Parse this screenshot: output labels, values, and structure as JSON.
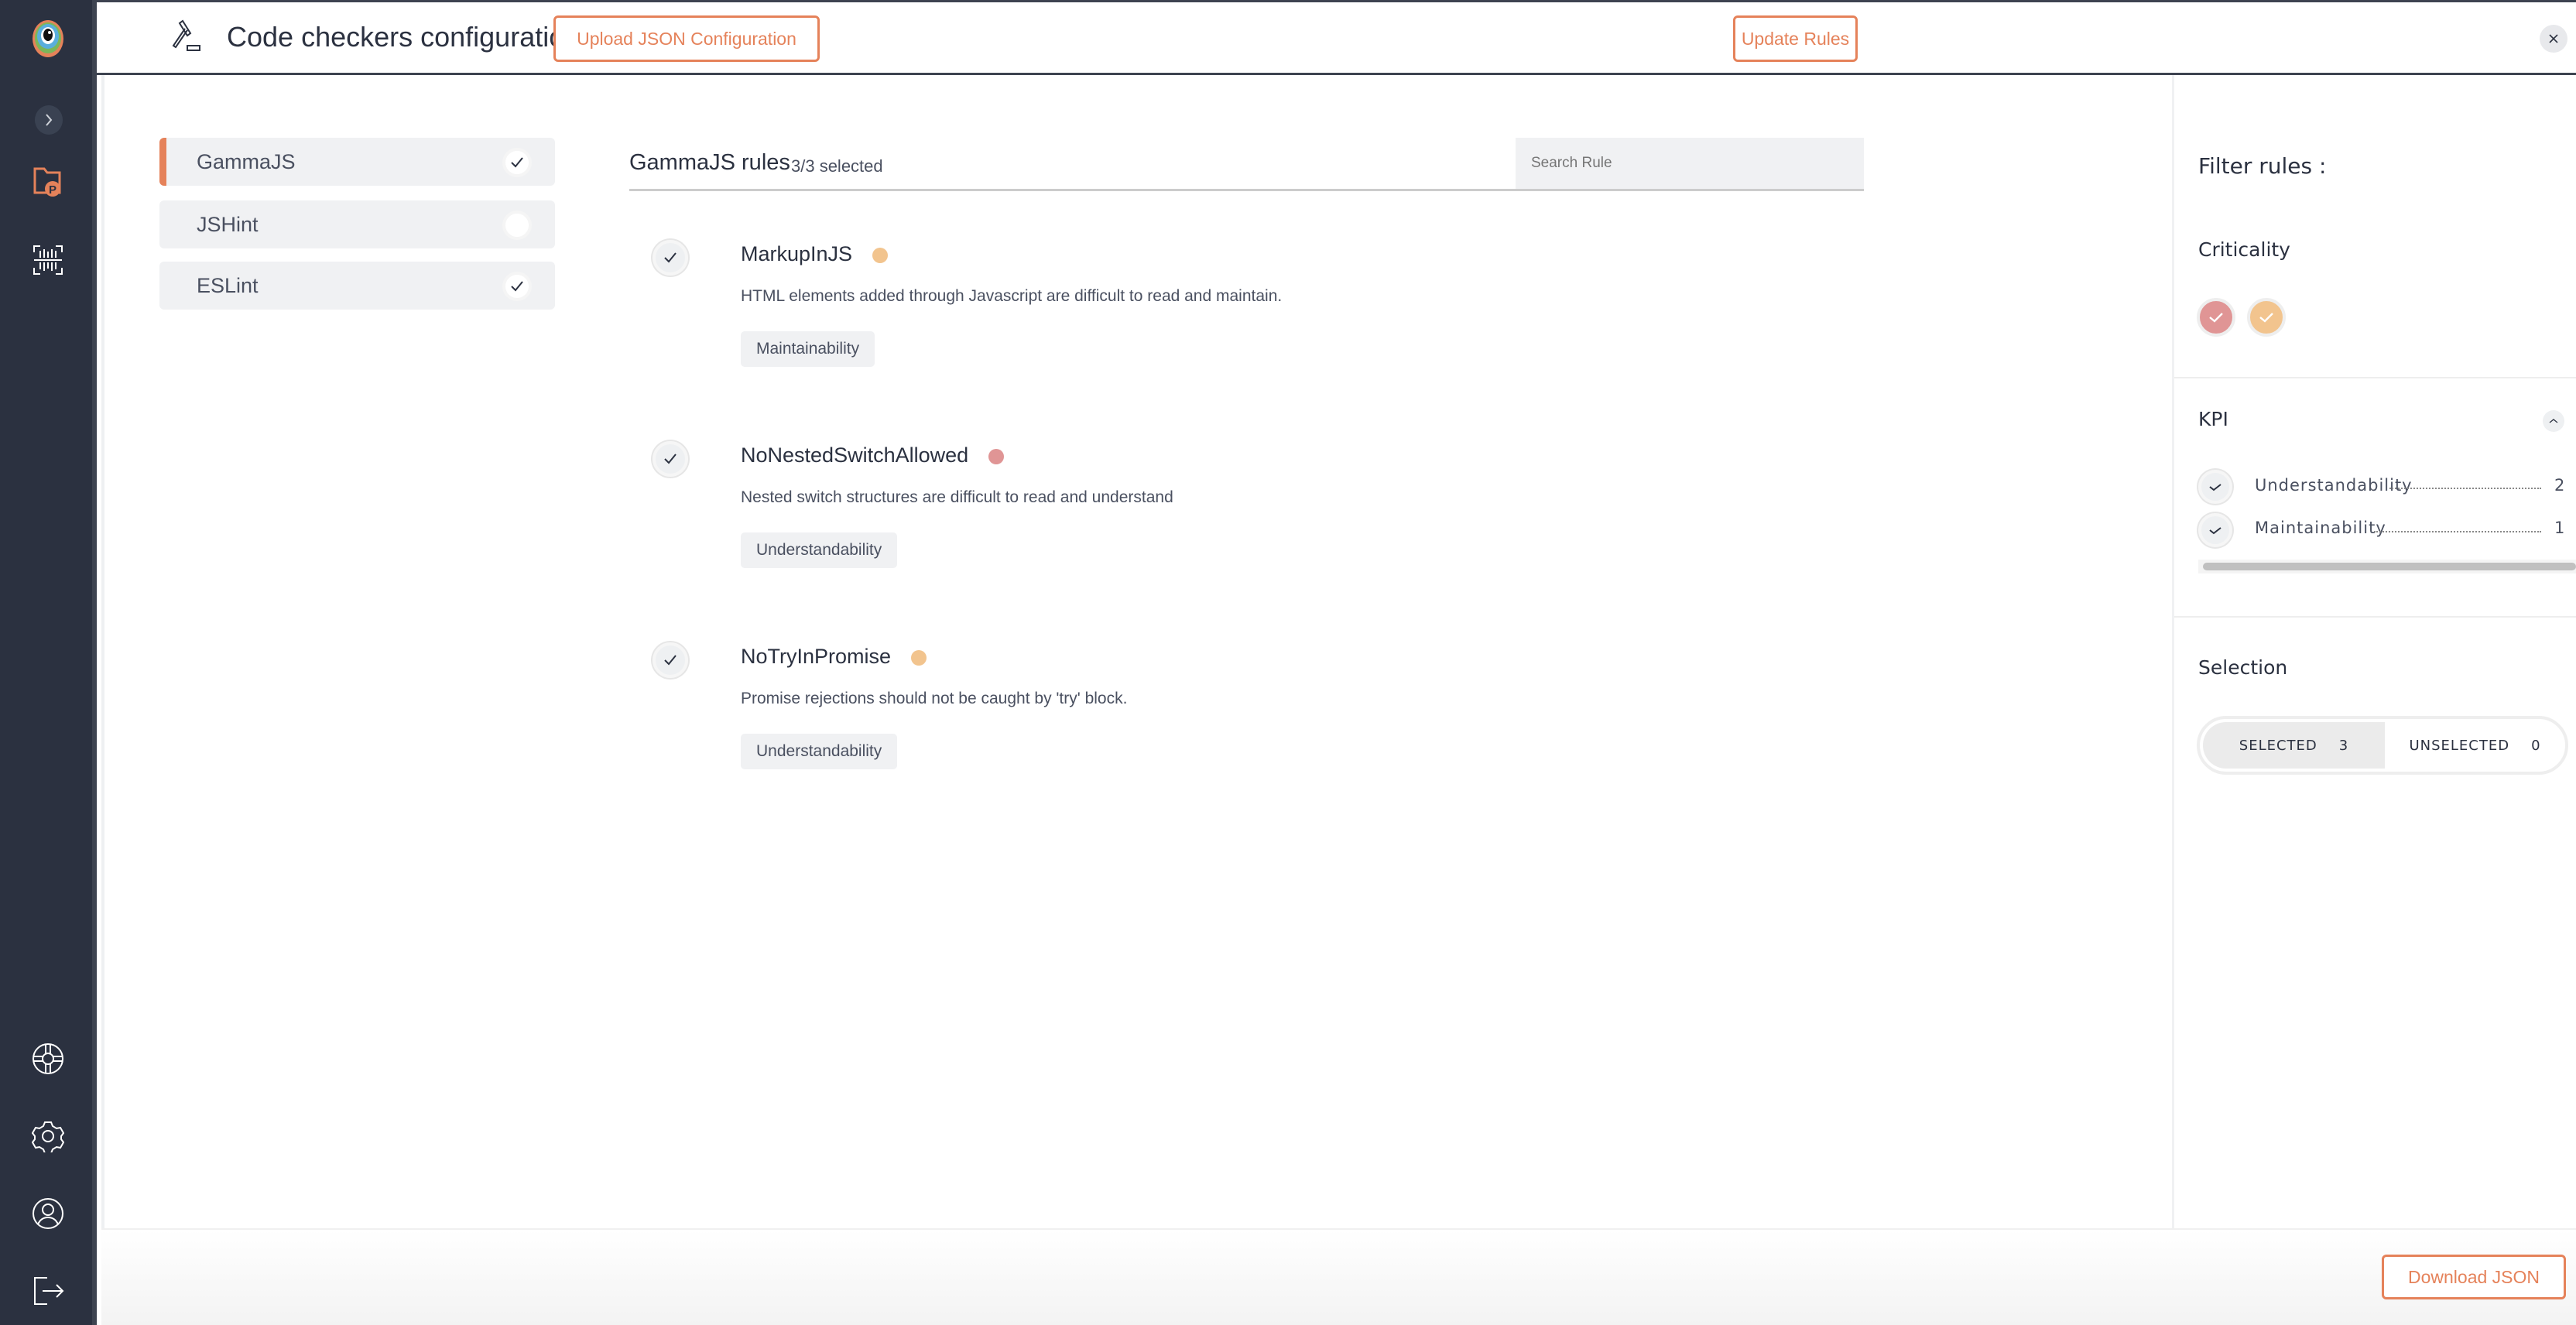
{
  "sidebar": {
    "items": [
      {
        "icon": "app-logo-icon"
      },
      {
        "icon": "chevron-right-icon"
      },
      {
        "icon": "project-folder-icon"
      },
      {
        "icon": "barcode-scan-icon"
      },
      {
        "icon": "help-lifebuoy-icon"
      },
      {
        "icon": "gear-icon"
      },
      {
        "icon": "user-icon"
      },
      {
        "icon": "logout-icon"
      }
    ]
  },
  "header": {
    "title": "Code checkers configuration",
    "icon": "gavel-icon",
    "upload_label": "Upload JSON Configuration",
    "update_label": "Update Rules",
    "close_icon": "close-icon"
  },
  "checkers": [
    {
      "label": "GammaJS",
      "checked": true,
      "active": true
    },
    {
      "label": "JSHint",
      "checked": false,
      "active": false
    },
    {
      "label": "ESLint",
      "checked": true,
      "active": false
    }
  ],
  "rules_panel": {
    "title": "GammaJS rules",
    "count": "3/3 selected",
    "search_placeholder": "Search Rule"
  },
  "rules": [
    {
      "name": "MarkupInJS",
      "criticality_color": "#f2c48e",
      "description": "HTML elements added through Javascript are difficult to read and maintain.",
      "tag": "Maintainability",
      "checked": true
    },
    {
      "name": "NoNestedSwitchAllowed",
      "criticality_color": "#e09595",
      "description": "Nested switch structures are difficult to read and understand",
      "tag": "Understandability",
      "checked": true
    },
    {
      "name": "NoTryInPromise",
      "criticality_color": "#f2c48e",
      "description": "Promise rejections should not be caught by 'try' block.",
      "tag": "Understandability",
      "checked": true
    }
  ],
  "filters": {
    "title": "Filter rules :",
    "criticality": {
      "label": "Criticality",
      "colors": [
        "#e09595",
        "#f2c48e"
      ]
    },
    "kpi": {
      "label": "KPI",
      "items": [
        {
          "label": "Understandability",
          "count": "2"
        },
        {
          "label": "Maintainability",
          "count": "1"
        }
      ]
    },
    "selection": {
      "label": "Selection",
      "selected_label": "SELECTED",
      "selected_count": "3",
      "unselected_label": "UNSELECTED",
      "unselected_count": "0"
    }
  },
  "footer": {
    "download_label": "Download JSON"
  },
  "colors": {
    "accent": "#e5825a",
    "sidebar": "#2b3140"
  }
}
